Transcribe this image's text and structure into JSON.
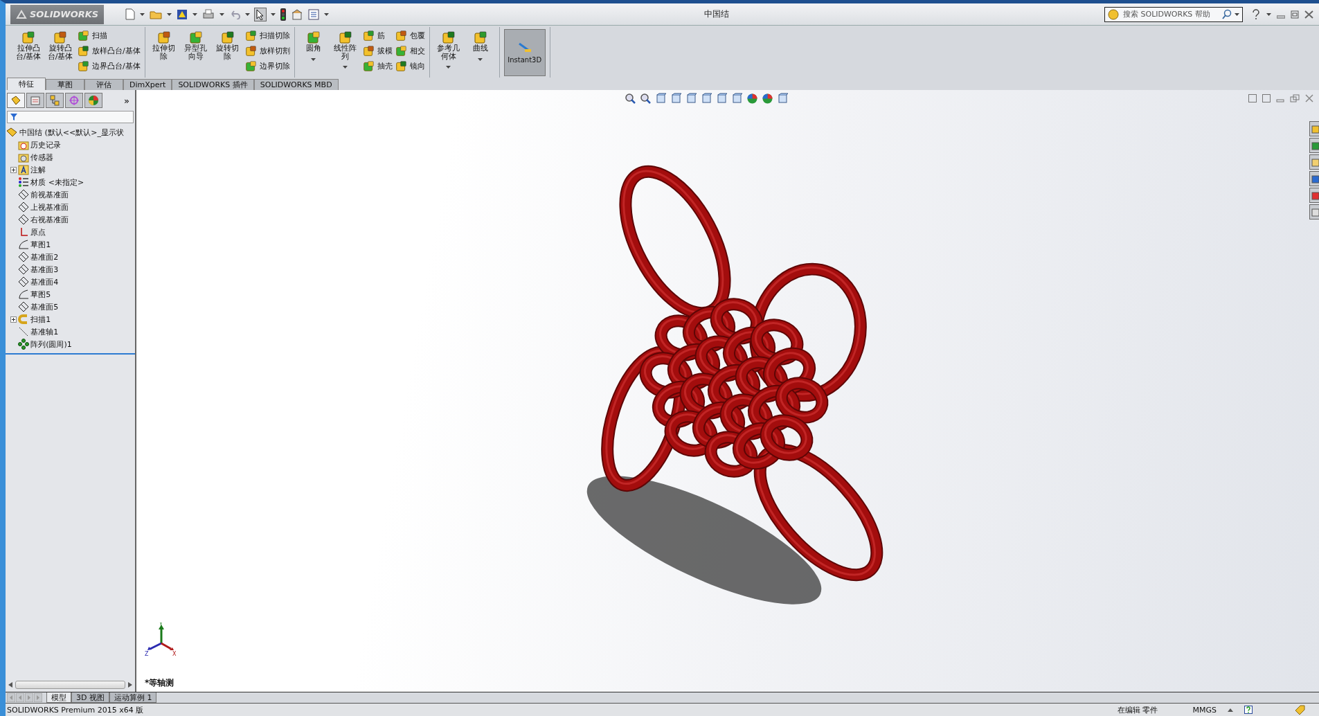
{
  "window": {
    "app": "SOLIDWORKS",
    "title": "中国结"
  },
  "help_search": {
    "placeholder": "搜索 SOLIDWORKS 帮助"
  },
  "command_groups": [
    {
      "items": [
        {
          "kind": "large",
          "label": "拉伸凸台/基体"
        },
        {
          "kind": "large",
          "label": "旋转凸台/基体"
        },
        {
          "kind": "stack",
          "labels": [
            "扫描",
            "放样凸台/基体",
            "边界凸台/基体"
          ]
        }
      ]
    },
    {
      "items": [
        {
          "kind": "large",
          "label": "拉伸切除"
        },
        {
          "kind": "large",
          "label": "异型孔向导"
        },
        {
          "kind": "large",
          "label": "旋转切除"
        },
        {
          "kind": "stack",
          "labels": [
            "扫描切除",
            "放样切割",
            "边界切除"
          ]
        }
      ]
    },
    {
      "items": [
        {
          "kind": "large",
          "label": "圆角",
          "dropdown": true
        },
        {
          "kind": "large",
          "label": "线性阵列",
          "dropdown": true
        },
        {
          "kind": "stack",
          "labels": [
            "筋",
            "拔模",
            "抽壳"
          ]
        },
        {
          "kind": "stack",
          "labels": [
            "包覆",
            "相交",
            "镜向"
          ]
        }
      ]
    },
    {
      "items": [
        {
          "kind": "large",
          "label": "参考几何体",
          "dropdown": true
        },
        {
          "kind": "large",
          "label": "曲线",
          "dropdown": true
        }
      ]
    },
    {
      "items": [
        {
          "kind": "toggle",
          "label": "Instant3D",
          "pressed": true
        }
      ]
    }
  ],
  "tabs": [
    {
      "label": "特征",
      "selected": true
    },
    {
      "label": "草图",
      "selected": false
    },
    {
      "label": "评估",
      "selected": false
    },
    {
      "label": "DimXpert",
      "selected": false
    },
    {
      "label": "SOLIDWORKS 插件",
      "selected": false
    },
    {
      "label": "SOLIDWORKS MBD",
      "selected": false
    }
  ],
  "panel_more": "»",
  "feature_tree": {
    "root": {
      "label": "中国结 (默认<<默认>_显示状",
      "children": [
        {
          "kind": "history",
          "label": "历史记录"
        },
        {
          "kind": "sensor",
          "label": "传感器"
        },
        {
          "kind": "annotation",
          "label": "注解",
          "expanded": false
        },
        {
          "kind": "material",
          "label": "材质 <未指定>"
        },
        {
          "kind": "plane",
          "label": "前视基准面"
        },
        {
          "kind": "plane",
          "label": "上视基准面"
        },
        {
          "kind": "plane",
          "label": "右视基准面"
        },
        {
          "kind": "origin",
          "label": "原点"
        },
        {
          "kind": "sketch",
          "label": "草图1"
        },
        {
          "kind": "plane",
          "label": "基准面2"
        },
        {
          "kind": "plane",
          "label": "基准面3"
        },
        {
          "kind": "plane",
          "label": "基准面4"
        },
        {
          "kind": "sketch",
          "label": "草图5"
        },
        {
          "kind": "plane",
          "label": "基准面5"
        },
        {
          "kind": "sweep",
          "label": "扫描1",
          "expanded": false
        },
        {
          "kind": "axis",
          "label": "基准轴1"
        },
        {
          "kind": "pattern",
          "label": "阵列(圆周)1"
        }
      ]
    }
  },
  "triad": {
    "x": "X",
    "y": "Y",
    "z": "Z"
  },
  "view_name": "*等轴测",
  "bottom_tabs": [
    {
      "label": "模型",
      "selected": true
    },
    {
      "label": "3D 视图",
      "selected": false
    },
    {
      "label": "运动算例 1",
      "selected": false
    }
  ],
  "status_bar": {
    "product": "SOLIDWORKS Premium 2015 x64 版",
    "mode": "在编辑 零件",
    "units": "MMGS"
  }
}
